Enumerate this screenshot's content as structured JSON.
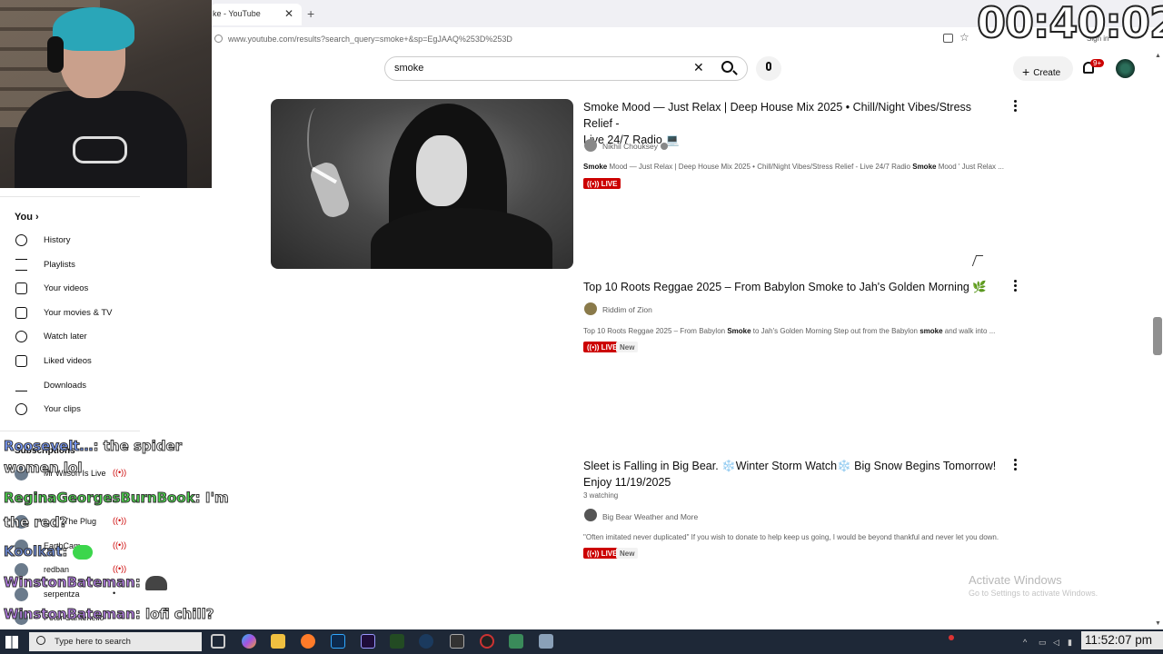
{
  "browser": {
    "tab_title": "ke - YouTube",
    "tab_close": "✕",
    "new_tab": "+",
    "url": "www.youtube.com/results?search_query=smoke+&sp=EgJAAQ%253D%253D",
    "sign_in": "Sign in"
  },
  "overlay": {
    "timer": "00:40:02"
  },
  "header": {
    "search_value": "smoke",
    "clear_icon": "✕",
    "create_label": "Create",
    "create_icon": "+",
    "notifications_badge": "9+"
  },
  "sidebar": {
    "you_label": "You",
    "you_chevron": "›",
    "items": [
      {
        "label": "History",
        "icon": "history-icon"
      },
      {
        "label": "Playlists",
        "icon": "playlists-icon"
      },
      {
        "label": "Your videos",
        "icon": "your-videos-icon"
      },
      {
        "label": "Your movies & TV",
        "icon": "movies-icon"
      },
      {
        "label": "Watch later",
        "icon": "watch-later-icon"
      },
      {
        "label": "Liked videos",
        "icon": "liked-icon"
      },
      {
        "label": "Downloads",
        "icon": "download-icon"
      },
      {
        "label": "Your clips",
        "icon": "clips-icon"
      }
    ],
    "subscriptions_title": "Subscriptions",
    "subscriptions": [
      {
        "label": "Mr Wilson Is Live",
        "live": "((•))"
      },
      {
        "label": "The Plug",
        "live": "((•))"
      },
      {
        "label": "EarthCam",
        "live": "((•))"
      },
      {
        "label": "redban",
        "live": "((•))"
      },
      {
        "label": "serpentza",
        "live": "•"
      },
      {
        "label": "Peter Santenello",
        "live": ""
      }
    ]
  },
  "chat": [
    {
      "user": "Roosevelt…",
      "msg": ": the spider"
    },
    {
      "user": "",
      "msg": "women lol"
    },
    {
      "user": "ReginaGeorgesBurnBook",
      "msg": ": I'm"
    },
    {
      "user": "",
      "msg": "the red?"
    },
    {
      "user": "Koolkat",
      "msg": ":"
    },
    {
      "user": "WinstonBateman",
      "msg": ":"
    },
    {
      "user": "WinstonBateman",
      "msg": ": lofi chill?"
    }
  ],
  "results": [
    {
      "title_line1": "Smoke Mood — Just Relax | Deep House Mix 2025 • Chill/Night Vibes/Stress Relief -",
      "title_line2": "Live 24/7 Radio 💻",
      "channel": "Nikhil Chouksey",
      "desc_bold1": "Smoke",
      "desc_mid": " Mood — Just Relax | Deep House Mix 2025 • Chill/Night Vibes/Stress Relief - Live 24/7 Radio ",
      "desc_bold2": "Smoke",
      "desc_end": " Mood ' Just Relax ...",
      "live": "((•)) LIVE"
    },
    {
      "title_line1": "Top 10 Roots Reggae 2025 – From Babylon Smoke to Jah's Golden Morning 🌿",
      "channel": "Riddim of Zion",
      "desc_a": "Top 10 Roots Reggae 2025 – From Babylon ",
      "desc_bold1": "Smoke",
      "desc_b": " to Jah's Golden Morning Step out from the Babylon ",
      "desc_bold2": "smoke",
      "desc_c": " and walk into ...",
      "live": "((•)) LIVE",
      "new": "New"
    },
    {
      "title_line1": "Sleet is Falling in Big Bear. ❄️Winter Storm Watch❄️ Big Snow Begins Tomorrow!",
      "title_line2": "Enjoy 11/19/2025",
      "watching": "3 watching",
      "channel": "Big Bear Weather and More",
      "desc": "\"Often imitated never duplicated\" If you wish to donate to help keep us going, I would be beyond thankful and never let you down.",
      "live": "((•)) LIVE",
      "new": "New"
    }
  ],
  "windows": {
    "activate_title": "Activate Windows",
    "activate_sub": "Go to Settings to activate Windows."
  },
  "taskbar": {
    "search_placeholder": "Type here to search",
    "clock": "11:52:07 pm",
    "tray_up": "^"
  }
}
